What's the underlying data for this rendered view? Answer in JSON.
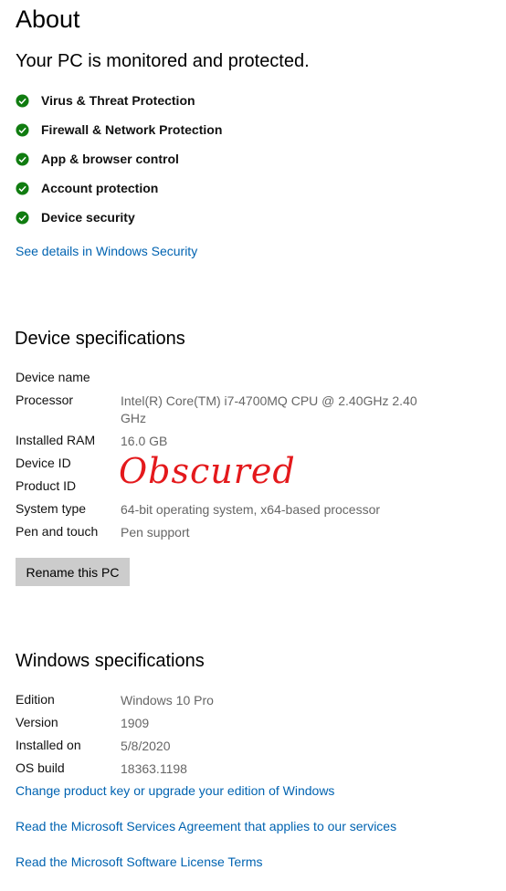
{
  "page": {
    "title": "About"
  },
  "security": {
    "heading": "Your PC is monitored and protected.",
    "items": [
      {
        "label": "Virus & Threat Protection",
        "icon": "green-check-icon"
      },
      {
        "label": "Firewall & Network Protection",
        "icon": "green-check-icon"
      },
      {
        "label": "App & browser control",
        "icon": "green-check-icon"
      },
      {
        "label": "Account protection",
        "icon": "green-check-icon"
      },
      {
        "label": "Device security",
        "icon": "green-check-icon"
      }
    ],
    "details_link": "See details in Windows Security",
    "check_color": "#107c10"
  },
  "device_specs": {
    "title": "Device specifications",
    "rows": [
      {
        "label": "Device name",
        "value": ""
      },
      {
        "label": "Processor",
        "value": "Intel(R) Core(TM) i7-4700MQ CPU @ 2.40GHz   2.40 GHz"
      },
      {
        "label": "Installed RAM",
        "value": "16.0 GB"
      },
      {
        "label": "Device ID",
        "value": ""
      },
      {
        "label": "Product ID",
        "value": ""
      },
      {
        "label": "System type",
        "value": "64-bit operating system, x64-based processor"
      },
      {
        "label": "Pen and touch",
        "value": "Pen support"
      }
    ],
    "obscured_text": "Obscured",
    "rename_button": "Rename this PC"
  },
  "windows_specs": {
    "title": "Windows specifications",
    "rows": [
      {
        "label": "Edition",
        "value": "Windows 10 Pro"
      },
      {
        "label": "Version",
        "value": "1909"
      },
      {
        "label": "Installed on",
        "value": "5/8/2020"
      },
      {
        "label": "OS build",
        "value": "18363.1198"
      }
    ],
    "links": [
      "Change product key or upgrade your edition of Windows",
      "Read the Microsoft Services Agreement that applies to our services",
      "Read the Microsoft Software License Terms"
    ]
  },
  "colors": {
    "link": "#0063b1",
    "value_text": "#666666",
    "button_bg": "#cccccc",
    "obscured": "#e4191c"
  }
}
